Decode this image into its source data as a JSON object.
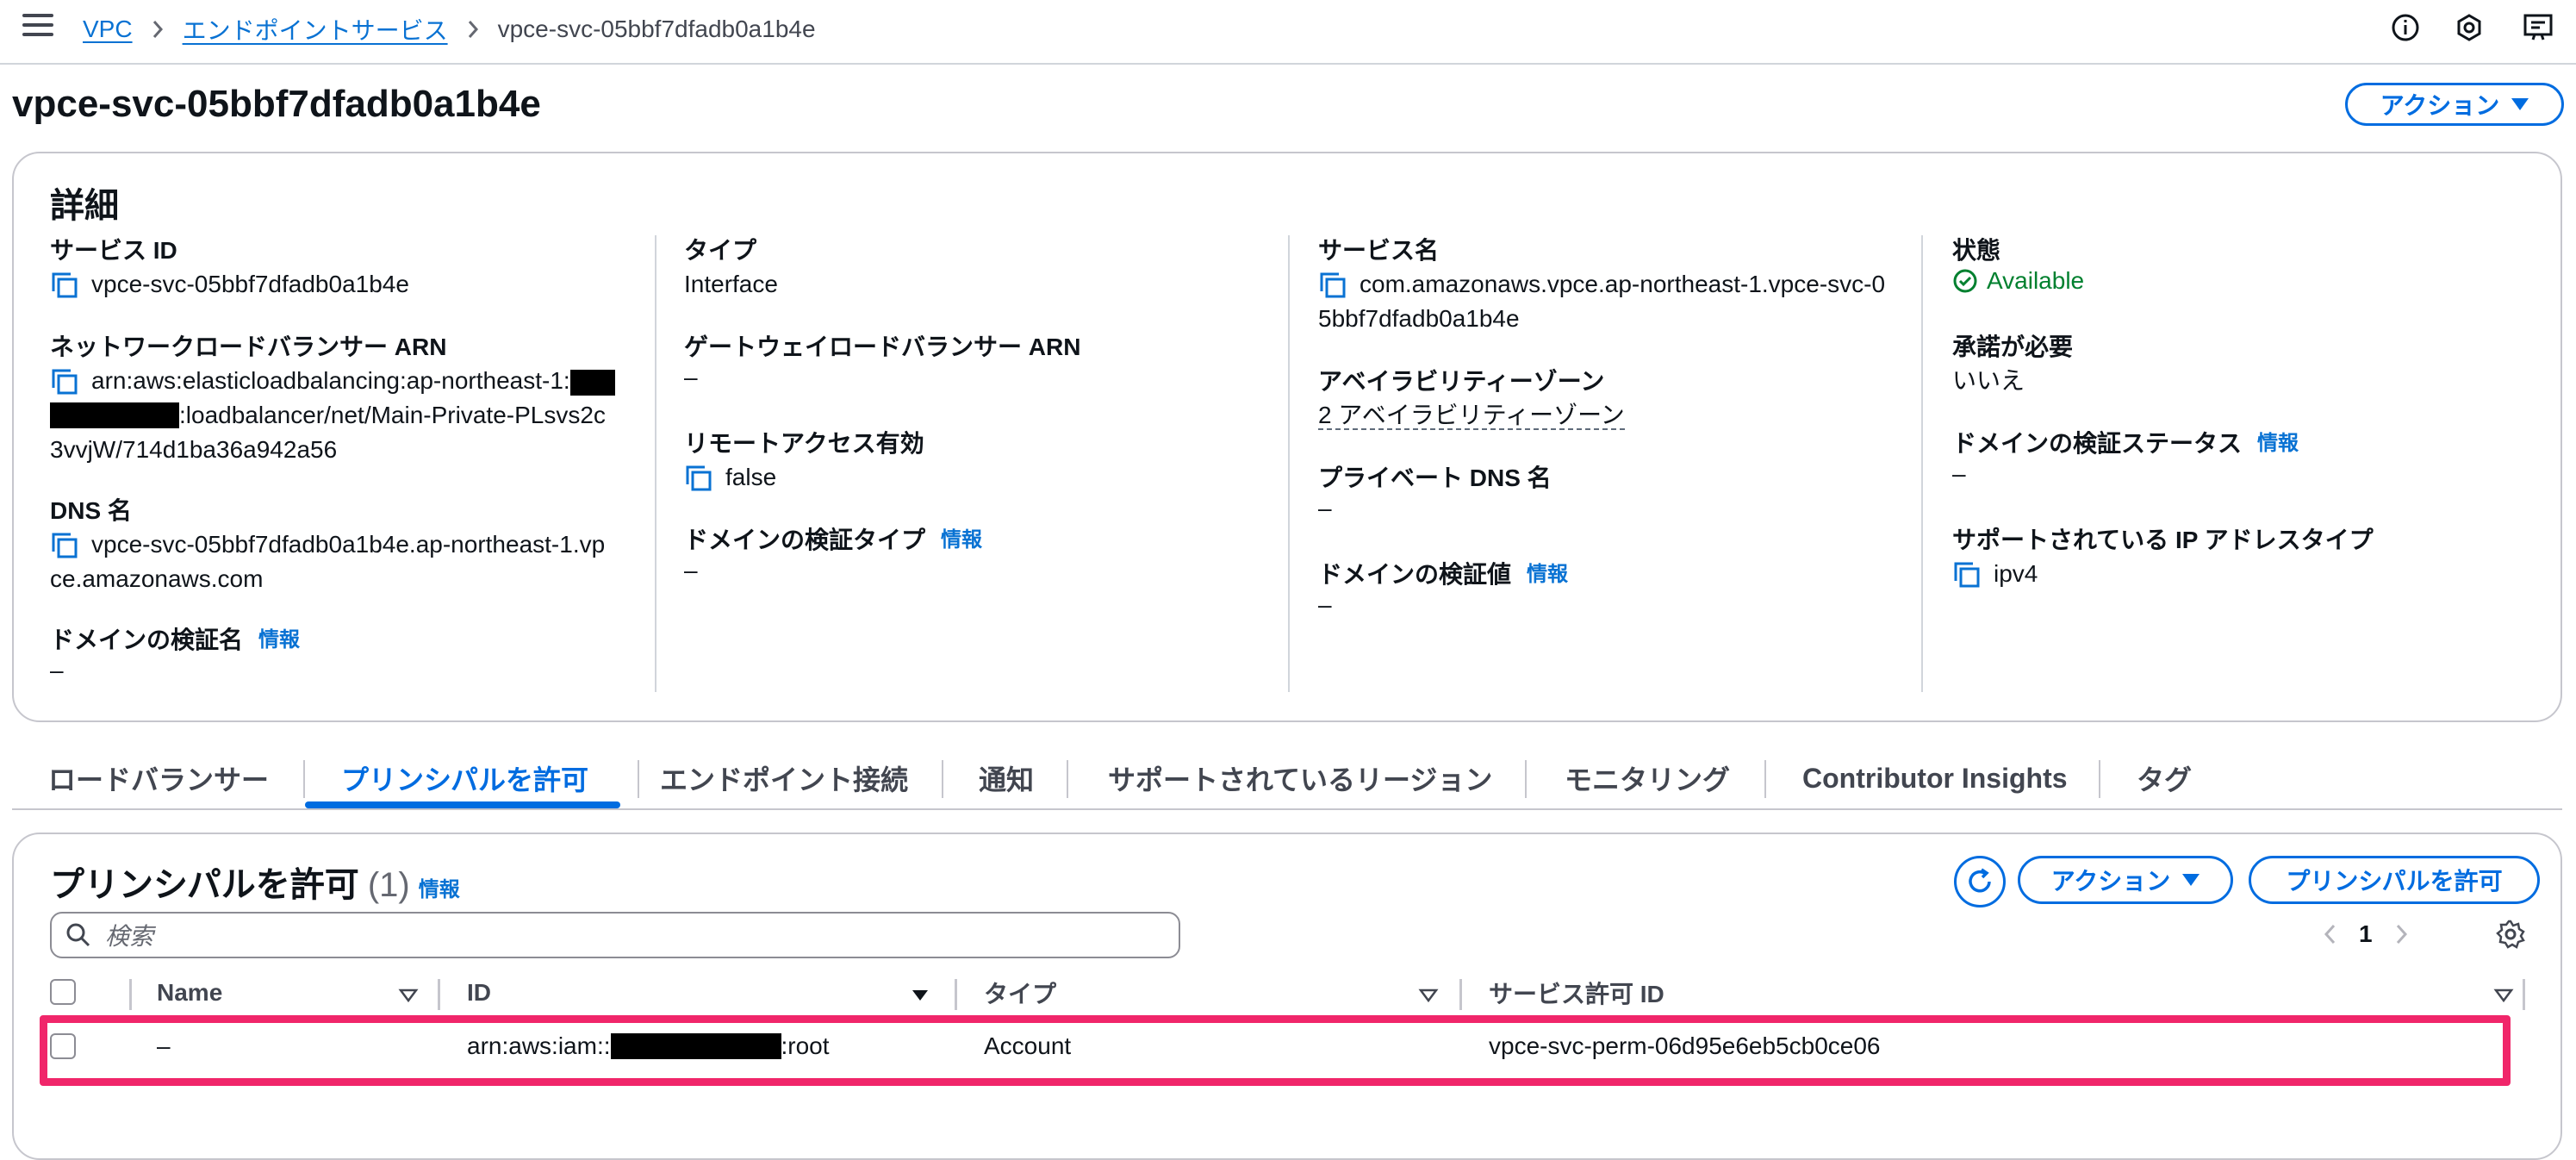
{
  "topbar": {
    "breadcrumbs": [
      "VPC",
      "エンドポイントサービス",
      "vpce-svc-05bbf7dfadb0a1b4e"
    ]
  },
  "page": {
    "title": "vpce-svc-05bbf7dfadb0a1b4e",
    "actions_label": "アクション"
  },
  "details": {
    "title": "詳細",
    "info_label": "情報",
    "service_id_label": "サービス ID",
    "service_id": "vpce-svc-05bbf7dfadb0a1b4e",
    "nlb_arn_label": "ネットワークロードバランサー ARN",
    "nlb_arn_part1": "arn:aws:elasticloadbalancing:ap-northeast-1:",
    "nlb_arn_part2": ":loadbalancer/net/Main-Private-PLsvs2c",
    "nlb_arn_part3": "3vvjW/714d1ba36a942a56",
    "dns_name_label": "DNS 名",
    "dns_name_line1": "vpce-svc-05bbf7dfadb0a1b4e.ap-northeast-1.vp",
    "dns_name_line2": "ce.amazonaws.com",
    "domain_verify_name_label": "ドメインの検証名",
    "domain_verify_name": "–",
    "type_label": "タイプ",
    "type": "Interface",
    "gwlb_arn_label": "ゲートウェイロードバランサー ARN",
    "gwlb_arn": "–",
    "remote_access_label": "リモートアクセス有効",
    "remote_access": "false",
    "domain_verify_type_label": "ドメインの検証タイプ",
    "domain_verify_type": "–",
    "service_name_label": "サービス名",
    "service_name_line1": "com.amazonaws.vpce.ap-northeast-1.vpce-svc-0",
    "service_name_line2": "5bbf7dfadb0a1b4e",
    "az_label": "アベイラビリティーゾーン",
    "az": "2 アベイラビリティーゾーン",
    "private_dns_label": "プライベート DNS 名",
    "private_dns": "–",
    "domain_verify_value_label": "ドメインの検証値",
    "domain_verify_value": "–",
    "state_label": "状態",
    "state": "Available",
    "acceptance_label": "承諾が必要",
    "acceptance": "いいえ",
    "domain_verify_status_label": "ドメインの検証ステータス",
    "domain_verify_status": "–",
    "ip_type_label": "サポートされている IP アドレスタイプ",
    "ip_type": "ipv4"
  },
  "tabs": [
    "ロードバランサー",
    "プリンシパルを許可",
    "エンドポイント接続",
    "通知",
    "サポートされているリージョン",
    "モニタリング",
    "Contributor Insights",
    "タグ"
  ],
  "principals": {
    "title": "プリンシパルを許可",
    "count": "(1)",
    "info_label": "情報",
    "actions_label": "アクション",
    "allow_button_label": "プリンシパルを許可",
    "search_placeholder": "検索",
    "page_number": "1",
    "columns": [
      "Name",
      "ID",
      "タイプ",
      "サービス許可 ID"
    ],
    "rows": [
      {
        "name": "–",
        "id_prefix": "arn:aws:iam::",
        "id_suffix": ":root",
        "type": "Account",
        "permission_id": "vpce-svc-perm-06d95e6eb5cb0ce06"
      }
    ]
  },
  "colors": {
    "link": "#0972d3",
    "primary": "#006ce0",
    "success": "#00802f",
    "highlight": "#f0266a"
  }
}
